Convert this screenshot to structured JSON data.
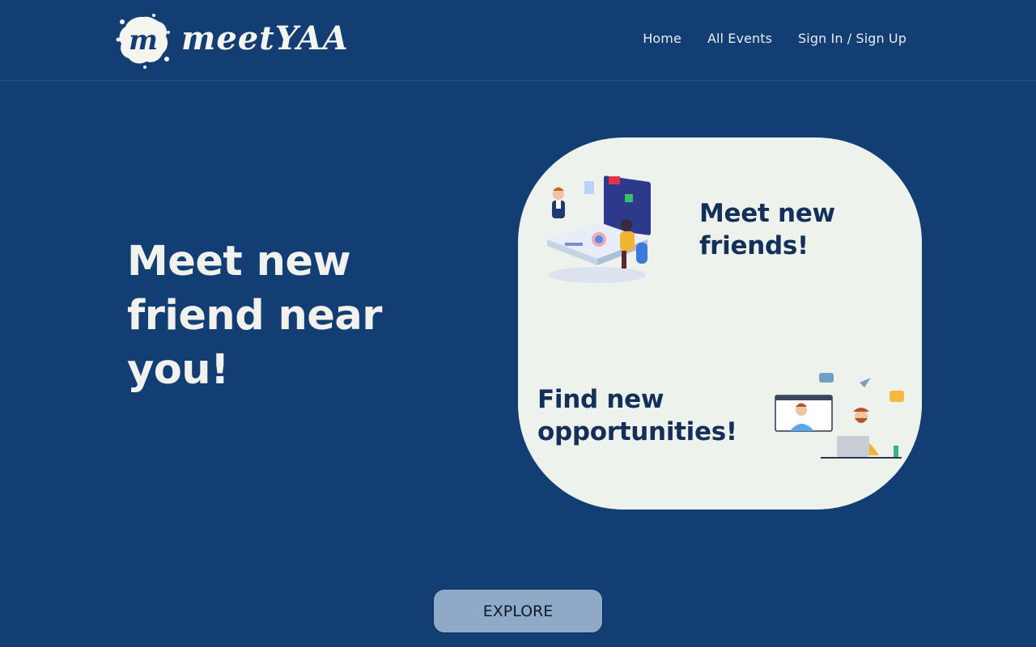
{
  "brand": {
    "name": "meetYAA",
    "logo_letter": "m",
    "logo_icon": "splash-logo-icon"
  },
  "nav": {
    "items": [
      {
        "label": "Home"
      },
      {
        "label": "All Events"
      },
      {
        "label": "Sign In / Sign Up"
      }
    ]
  },
  "hero": {
    "title": "Meet new friend near you!"
  },
  "card": {
    "heading_one": "Meet new friends!",
    "heading_two": "Find new opportunities!",
    "illustration_one": "team-meeting-illustration",
    "illustration_two": "video-call-illustration"
  },
  "cta": {
    "label": "EXPLORE"
  },
  "colors": {
    "background": "#133e73",
    "card": "#eef2ec",
    "heading": "#14305a",
    "button": "#8faac8"
  }
}
